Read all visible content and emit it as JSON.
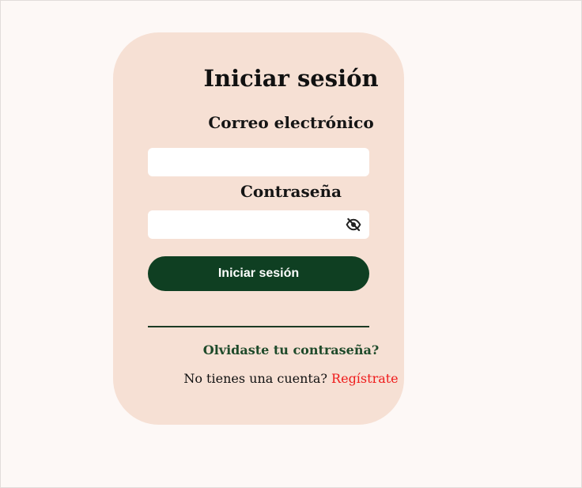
{
  "login": {
    "title": "Iniciar sesión",
    "email_label": "Correo electrónico",
    "email_value": "",
    "password_label": "Contraseña",
    "password_value": "",
    "toggle_icon": "eye-slash-icon",
    "submit_label": "Iniciar sesión",
    "forgot_label": "Olvidaste tu contraseña?",
    "no_account_text": "No tienes una cuenta?",
    "signup_label": "Regístrate"
  },
  "colors": {
    "page_background": "#fdf8f6",
    "card_background": "#f6e0d4",
    "button_background": "#0f3f22",
    "link_green": "#1e4a2a",
    "signup_red": "#ef1b1b"
  }
}
